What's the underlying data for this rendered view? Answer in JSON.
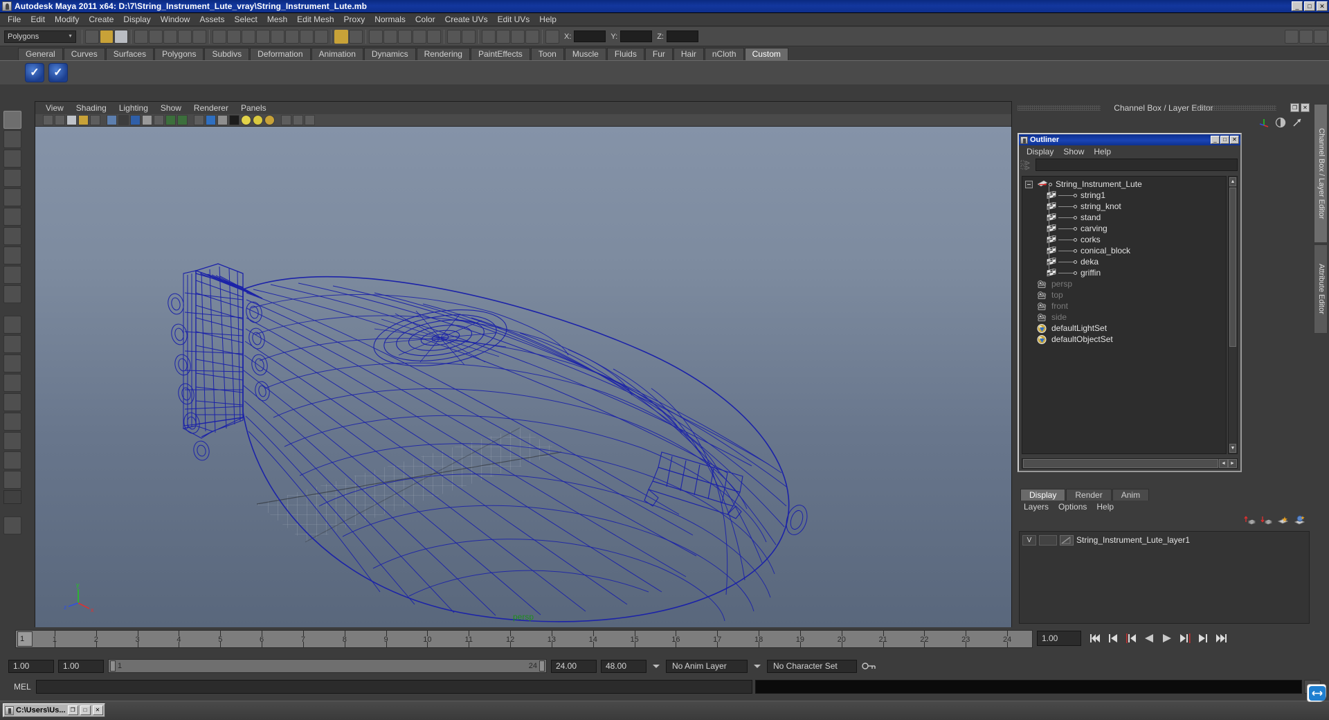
{
  "window": {
    "title": "Autodesk Maya 2011 x64: D:\\7\\String_Instrument_Lute_vray\\String_Instrument_Lute.mb",
    "min_label": "_",
    "max_label": "□",
    "close_label": "✕"
  },
  "menubar": {
    "items": [
      "File",
      "Edit",
      "Modify",
      "Create",
      "Display",
      "Window",
      "Assets",
      "Select",
      "Mesh",
      "Edit Mesh",
      "Proxy",
      "Normals",
      "Color",
      "Create UVs",
      "Edit UVs",
      "Help"
    ]
  },
  "toolbar": {
    "mode_value": "Polygons",
    "axis_labels": [
      "X:",
      "Y:",
      "Z:"
    ],
    "axis_values": [
      "",
      "",
      ""
    ]
  },
  "shelf": {
    "tabs": [
      "General",
      "Curves",
      "Surfaces",
      "Polygons",
      "Subdivs",
      "Deformation",
      "Animation",
      "Dynamics",
      "Rendering",
      "PaintEffects",
      "Toon",
      "Muscle",
      "Fluids",
      "Fur",
      "Hair",
      "nCloth",
      "Custom"
    ],
    "active_tab": "Custom",
    "buttons": [
      "check-shelf-button-1",
      "check-shelf-button-2"
    ]
  },
  "viewport": {
    "menus": [
      "View",
      "Shading",
      "Lighting",
      "Show",
      "Renderer",
      "Panels"
    ],
    "camera_label": "persp",
    "axis_labels": {
      "x": "x",
      "y": "y",
      "z": "z"
    },
    "background_top": "#8593a8",
    "background_bottom": "#59677c",
    "wireframe_color": "#1b22a8"
  },
  "channel_box": {
    "header": "Channel Box / Layer Editor",
    "restore_label": "❐",
    "close_label": "✕"
  },
  "outliner": {
    "title": "Outliner",
    "min_label": "_",
    "max_label": "□",
    "close_label": "✕",
    "menus": [
      "Display",
      "Show",
      "Help"
    ],
    "search_value": "",
    "items": [
      {
        "label": "String_Instrument_Lute",
        "type": "transform",
        "indent": 0,
        "dim": false,
        "expander": true
      },
      {
        "label": "string1",
        "type": "mesh",
        "indent": 1,
        "dim": false,
        "expander": false
      },
      {
        "label": "string_knot",
        "type": "mesh",
        "indent": 1,
        "dim": false,
        "expander": false
      },
      {
        "label": "stand",
        "type": "mesh",
        "indent": 1,
        "dim": false,
        "expander": false
      },
      {
        "label": "carving",
        "type": "mesh",
        "indent": 1,
        "dim": false,
        "expander": false
      },
      {
        "label": "corks",
        "type": "mesh",
        "indent": 1,
        "dim": false,
        "expander": false
      },
      {
        "label": "conical_block",
        "type": "mesh",
        "indent": 1,
        "dim": false,
        "expander": false
      },
      {
        "label": "deka",
        "type": "mesh",
        "indent": 1,
        "dim": false,
        "expander": false
      },
      {
        "label": "griffin",
        "type": "mesh",
        "indent": 1,
        "dim": false,
        "expander": false
      },
      {
        "label": "persp",
        "type": "camera",
        "indent": 0,
        "dim": true,
        "expander": false
      },
      {
        "label": "top",
        "type": "camera",
        "indent": 0,
        "dim": true,
        "expander": false
      },
      {
        "label": "front",
        "type": "camera",
        "indent": 0,
        "dim": true,
        "expander": false
      },
      {
        "label": "side",
        "type": "camera",
        "indent": 0,
        "dim": true,
        "expander": false
      },
      {
        "label": "defaultLightSet",
        "type": "set",
        "indent": 0,
        "dim": false,
        "expander": false
      },
      {
        "label": "defaultObjectSet",
        "type": "set",
        "indent": 0,
        "dim": false,
        "expander": false
      }
    ],
    "scroll_up": "▲",
    "scroll_down": "▼",
    "scroll_left": "◄",
    "scroll_right": "►"
  },
  "layer_editor": {
    "tabs": [
      "Display",
      "Render",
      "Anim"
    ],
    "active_tab": "Display",
    "menus": [
      "Layers",
      "Options",
      "Help"
    ],
    "layers": [
      {
        "visibility": "V",
        "playback": "",
        "name": "String_Instrument_Lute_layer1"
      }
    ]
  },
  "side_tabs": {
    "items": [
      "Channel Box / Layer Editor",
      "Attribute Editor"
    ],
    "active": "Channel Box / Layer Editor"
  },
  "time_slider": {
    "current_frame": "1",
    "ticks": [
      1,
      2,
      3,
      4,
      5,
      6,
      7,
      8,
      9,
      10,
      11,
      12,
      13,
      14,
      15,
      16,
      17,
      18,
      19,
      20,
      21,
      22,
      23,
      24
    ],
    "frame_field": "1.00"
  },
  "playback": {
    "buttons": [
      "go-to-start",
      "step-back-keyframe",
      "step-back-frame",
      "play-backwards",
      "play-forwards",
      "step-forward-frame",
      "step-forward-keyframe",
      "go-to-end"
    ]
  },
  "range_slider": {
    "start_field": "1.00",
    "start_playback_field": "1.00",
    "range_start": "1",
    "range_end": "24",
    "end_playback_field": "24.00",
    "end_field": "48.00",
    "anim_layer": "No Anim Layer",
    "character_set": "No Character Set"
  },
  "command_line": {
    "label": "MEL",
    "input_value": "",
    "output_value": ""
  },
  "taskbar": {
    "button_label": "C:\\Users\\Us...",
    "restore_label": "❐",
    "max_label": "□",
    "close_label": "✕"
  }
}
